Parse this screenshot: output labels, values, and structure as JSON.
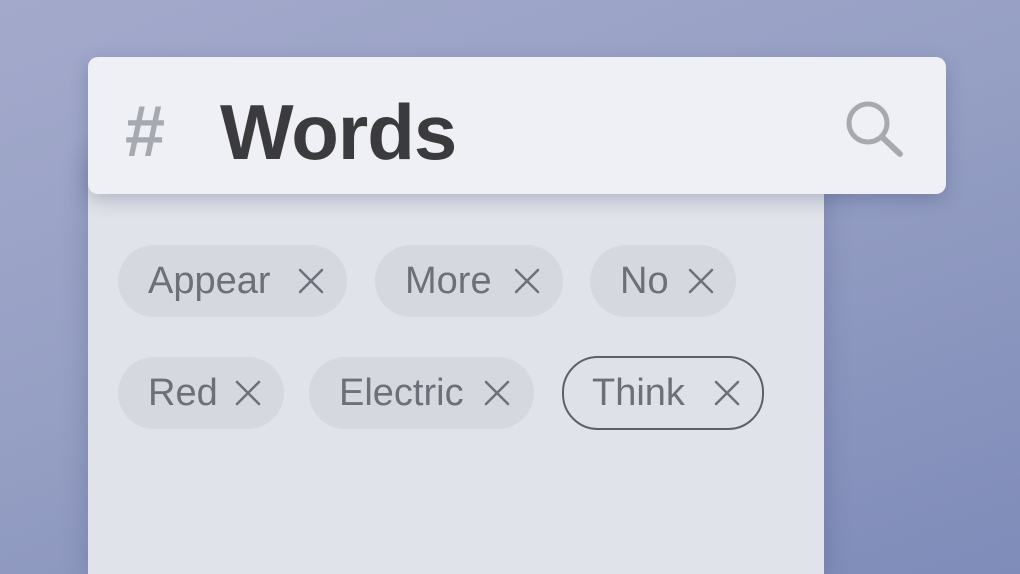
{
  "header": {
    "hash_symbol": "#",
    "title": "Words",
    "search_icon": "search-icon"
  },
  "tags": {
    "items": [
      {
        "label": "Appear",
        "selected": false
      },
      {
        "label": "More",
        "selected": false
      },
      {
        "label": "No",
        "selected": false
      },
      {
        "label": "Red",
        "selected": false
      },
      {
        "label": "Electric",
        "selected": false
      },
      {
        "label": "Think",
        "selected": true
      }
    ],
    "remove_icon": "close-icon"
  },
  "colors": {
    "background": "#8f99c1",
    "panel": "#e1e3ea",
    "header": "#eef0f5",
    "chip": "#d6d8df",
    "chip_text": "#6c7078",
    "title_text": "#3b3b3d",
    "selected_border": "#5c6068"
  }
}
